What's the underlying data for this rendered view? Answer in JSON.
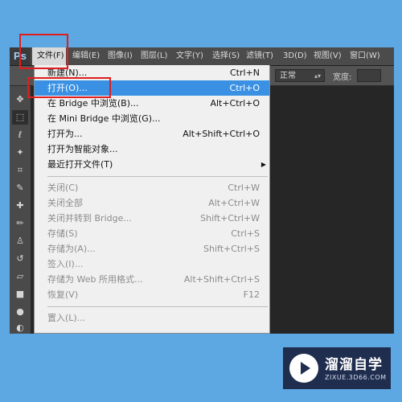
{
  "app": {
    "logo": "Ps"
  },
  "menubar": {
    "items": [
      {
        "label": "文件(F)",
        "active": true
      },
      {
        "label": "编辑(E)"
      },
      {
        "label": "图像(I)"
      },
      {
        "label": "图层(L)"
      },
      {
        "label": "文字(Y)"
      },
      {
        "label": "选择(S)"
      },
      {
        "label": "滤镜(T)"
      },
      {
        "label": "3D(D)"
      },
      {
        "label": "视图(V)"
      },
      {
        "label": "窗口(W)"
      }
    ]
  },
  "options_bar": {
    "mode_value": "正常",
    "width_label": "宽度:"
  },
  "file_menu": {
    "items": [
      {
        "label": "新建(N)...",
        "shortcut": "Ctrl+N"
      },
      {
        "label": "打开(O)...",
        "shortcut": "Ctrl+O",
        "highlighted": true
      },
      {
        "label": "在 Bridge 中浏览(B)...",
        "shortcut": "Alt+Ctrl+O"
      },
      {
        "label": "在 Mini Bridge 中浏览(G)...",
        "shortcut": ""
      },
      {
        "label": "打开为...",
        "shortcut": "Alt+Shift+Ctrl+O"
      },
      {
        "label": "打开为智能对象...",
        "shortcut": ""
      },
      {
        "label": "最近打开文件(T)",
        "shortcut": "",
        "submenu": true
      },
      {
        "label": "关闭(C)",
        "shortcut": "Ctrl+W",
        "disabled": true
      },
      {
        "label": "关闭全部",
        "shortcut": "Alt+Ctrl+W",
        "disabled": true
      },
      {
        "label": "关闭并转到 Bridge...",
        "shortcut": "Shift+Ctrl+W",
        "disabled": true
      },
      {
        "label": "存储(S)",
        "shortcut": "Ctrl+S",
        "disabled": true
      },
      {
        "label": "存储为(A)...",
        "shortcut": "Shift+Ctrl+S",
        "disabled": true
      },
      {
        "label": "签入(I)...",
        "shortcut": "",
        "disabled": true
      },
      {
        "label": "存储为 Web 所用格式...",
        "shortcut": "Alt+Shift+Ctrl+S",
        "disabled": true
      },
      {
        "label": "恢复(V)",
        "shortcut": "F12",
        "disabled": true
      },
      {
        "label": "置入(L)...",
        "shortcut": "",
        "disabled": true
      }
    ]
  },
  "watermark": {
    "name": "溜溜自学",
    "url": "ZIXUE.3D66.COM"
  },
  "colors": {
    "background": "#5da7e2",
    "highlight": "#3a91e3",
    "annotation_red": "#e01e1e"
  }
}
